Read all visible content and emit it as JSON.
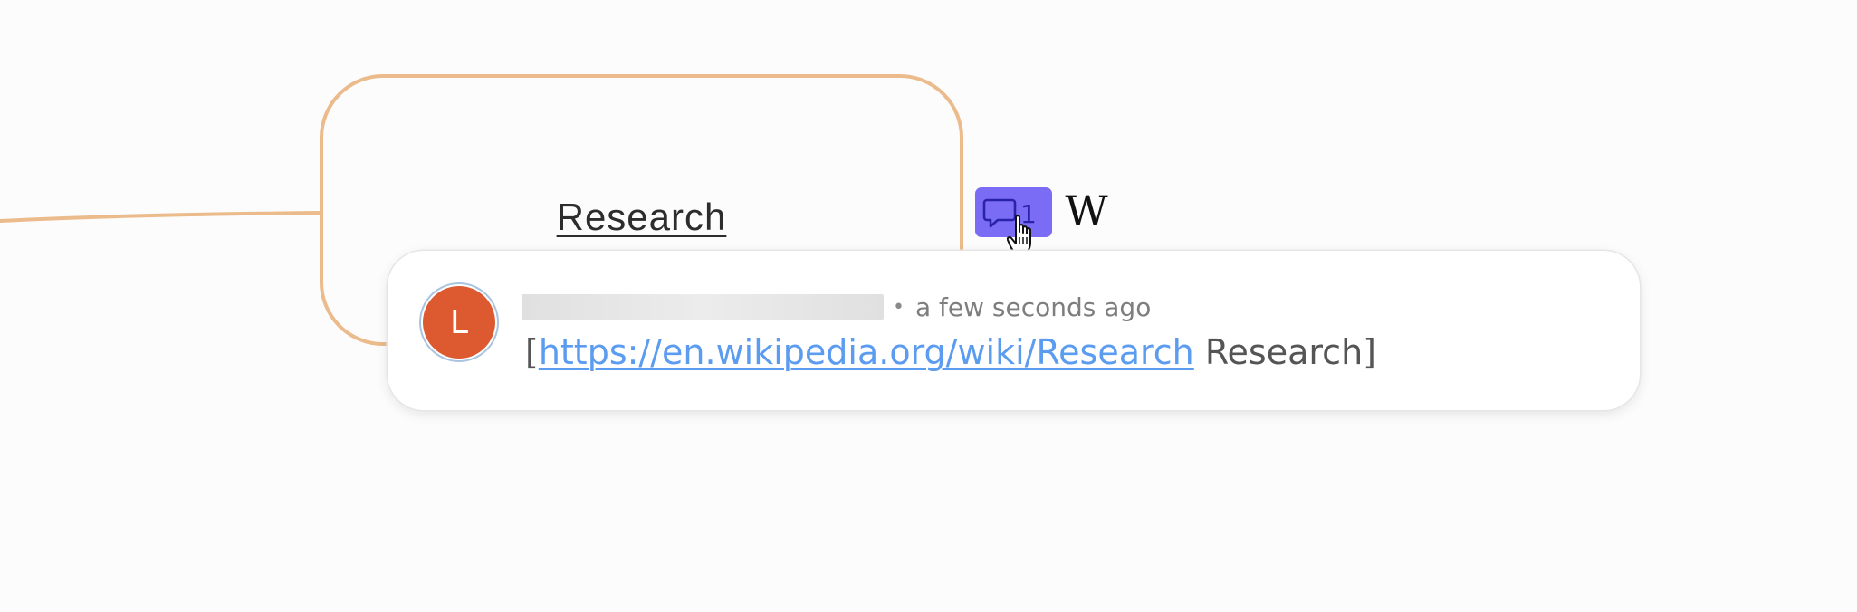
{
  "mindmap": {
    "node": {
      "title": "Research"
    },
    "comment_badge": {
      "count": "1",
      "icon": "speech-bubble-icon",
      "color": "#7b6cf6"
    },
    "wiki_icon": {
      "glyph": "W",
      "icon": "wikipedia-icon"
    },
    "connector_color": "#ebbb8b"
  },
  "comment_popup": {
    "avatar": {
      "initial": "L",
      "color": "#dd5a31"
    },
    "author_name": "",
    "separator": "•",
    "timestamp": "a few seconds ago",
    "body": {
      "open_bracket": "[",
      "link_text": "https://en.wikipedia.org/wiki/Research",
      "trailing_text": " Research]"
    }
  }
}
